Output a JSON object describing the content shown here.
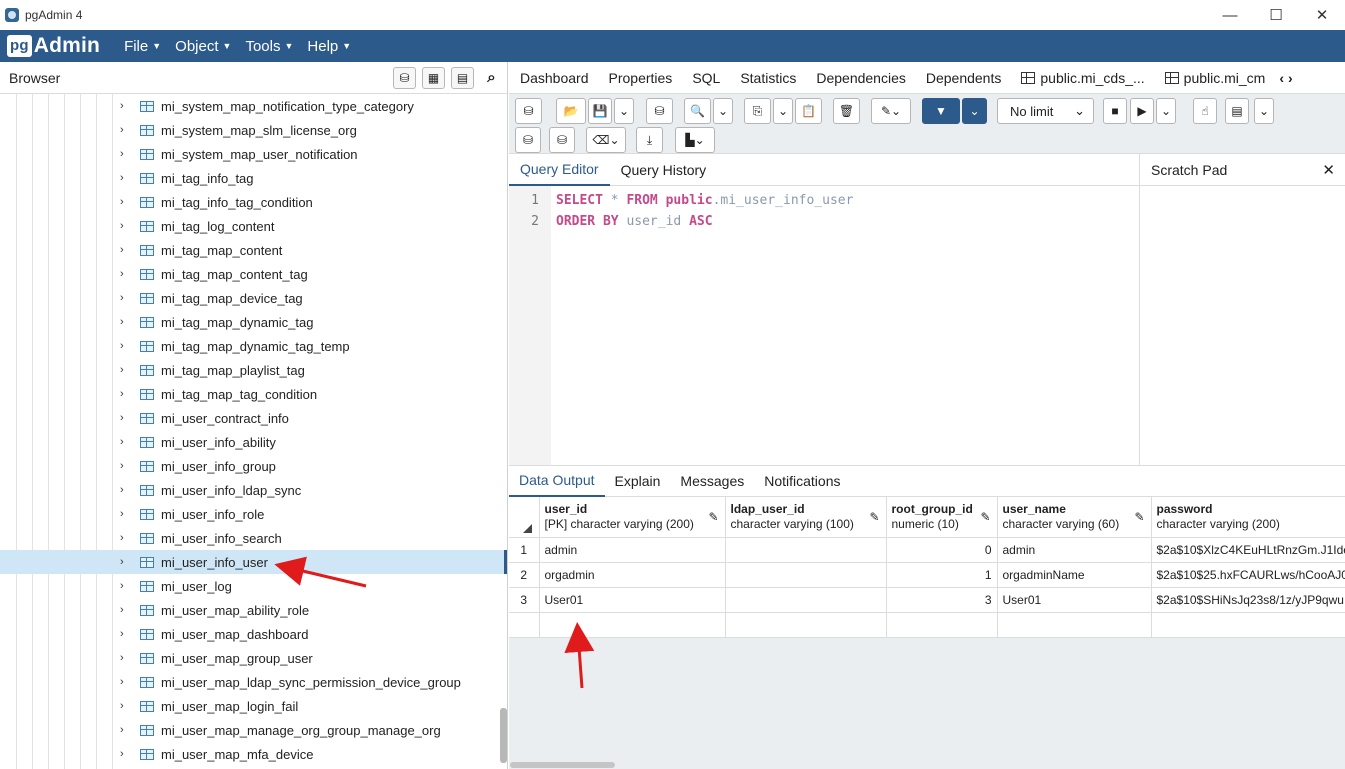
{
  "window": {
    "title": "pgAdmin 4",
    "minimize": "—",
    "maximize": "☐",
    "close": "✕"
  },
  "menubar": {
    "logo_pg": "pg",
    "logo_text": "Admin",
    "items": [
      "File",
      "Object",
      "Tools",
      "Help"
    ]
  },
  "browser": {
    "title": "Browser",
    "tree_items": [
      "mi_system_map_notification_type_category",
      "mi_system_map_slm_license_org",
      "mi_system_map_user_notification",
      "mi_tag_info_tag",
      "mi_tag_info_tag_condition",
      "mi_tag_log_content",
      "mi_tag_map_content",
      "mi_tag_map_content_tag",
      "mi_tag_map_device_tag",
      "mi_tag_map_dynamic_tag",
      "mi_tag_map_dynamic_tag_temp",
      "mi_tag_map_playlist_tag",
      "mi_tag_map_tag_condition",
      "mi_user_contract_info",
      "mi_user_info_ability",
      "mi_user_info_group",
      "mi_user_info_ldap_sync",
      "mi_user_info_role",
      "mi_user_info_search",
      "mi_user_info_user",
      "mi_user_log",
      "mi_user_map_ability_role",
      "mi_user_map_dashboard",
      "mi_user_map_group_user",
      "mi_user_map_ldap_sync_permission_device_group",
      "mi_user_map_login_fail",
      "mi_user_map_manage_org_group_manage_org",
      "mi_user_map_mfa_device"
    ],
    "selected_item": "mi_user_info_user"
  },
  "tabs": [
    "Dashboard",
    "Properties",
    "SQL",
    "Statistics",
    "Dependencies",
    "Dependents",
    "public.mi_cds_...",
    "public.mi_cm"
  ],
  "toolbar": {
    "limit_value": "No limit"
  },
  "editor": {
    "tabs": [
      "Query Editor",
      "Query History"
    ],
    "scratch_pad_title": "Scratch Pad",
    "lines": [
      {
        "number": "1",
        "tokens": [
          [
            "kw",
            "SELECT"
          ],
          [
            "op",
            " * "
          ],
          [
            "kw",
            "FROM"
          ],
          [
            "sp",
            " "
          ],
          [
            "sch",
            "public"
          ],
          [
            "op",
            "."
          ],
          [
            "id",
            "mi_user_info_user"
          ]
        ]
      },
      {
        "number": "2",
        "tokens": [
          [
            "kw",
            "ORDER BY"
          ],
          [
            "sp",
            " "
          ],
          [
            "id",
            "user_id"
          ],
          [
            "sp",
            " "
          ],
          [
            "kw",
            "ASC"
          ]
        ]
      }
    ]
  },
  "output": {
    "tabs": [
      "Data Output",
      "Explain",
      "Messages",
      "Notifications"
    ],
    "columns": [
      {
        "name": "user_id",
        "type": "[PK] character varying (200)"
      },
      {
        "name": "ldap_user_id",
        "type": "character varying (100)"
      },
      {
        "name": "root_group_id",
        "type": "numeric (10)"
      },
      {
        "name": "user_name",
        "type": "character varying (60)"
      },
      {
        "name": "password",
        "type": "character varying (200)"
      }
    ],
    "rows": [
      {
        "num": "1",
        "cells": [
          "admin",
          "",
          "0",
          "admin",
          "$2a$10$XlzC4KEuHLtRnzGm.J1Ide"
        ]
      },
      {
        "num": "2",
        "cells": [
          "orgadmin",
          "",
          "1",
          "orgadminName",
          "$2a$10$25.hxFCAURLws/hCooAJ0"
        ]
      },
      {
        "num": "3",
        "cells": [
          "User01",
          "",
          "3",
          "User01",
          "$2a$10$SHiNsJq23s8/1z/yJP9qwu"
        ]
      }
    ]
  },
  "colors": {
    "brand": "#2c5a8a",
    "keyword": "#c44a8a",
    "annotation_arrow": "#e01b1b",
    "selected_row": "#cfe6f7"
  }
}
